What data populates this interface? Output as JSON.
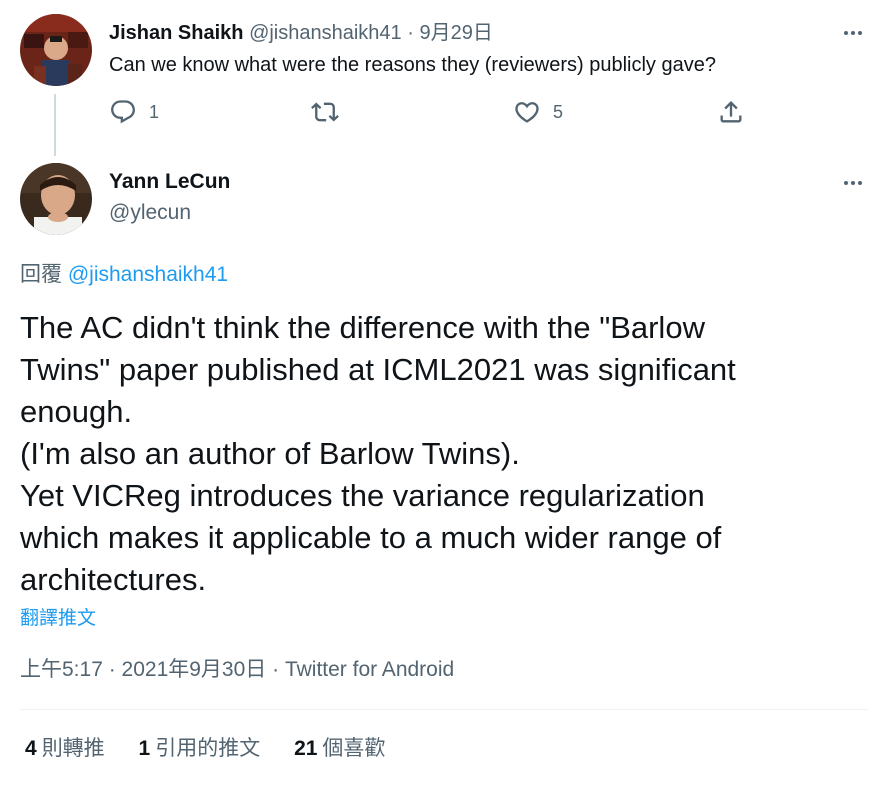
{
  "reply": {
    "name": "Jishan Shaikh",
    "handle": "@jishanshaikh41",
    "separator": "·",
    "date": "9月29日",
    "text": "Can we know what were the reasons they (reviewers) publicly gave?",
    "reply_count": "1",
    "like_count": "5"
  },
  "main": {
    "name": "Yann LeCun",
    "handle": "@ylecun",
    "replying_prefix": "回覆 ",
    "replying_mention": "@jishanshaikh41",
    "text_lines": [
      "The AC didn't think the difference with the \"Barlow",
      "Twins\" paper published at ICML2021 was significant",
      "enough.",
      "(I'm also an author of Barlow Twins).",
      "Yet VICReg introduces the variance regularization",
      "which makes it applicable to a much wider range of",
      "architectures."
    ],
    "translate_label": "翻譯推文",
    "time": "上午5:17 · 2021年9月30日 · ",
    "source": "Twitter for Android"
  },
  "stats": [
    {
      "num": "4",
      "label": "則轉推"
    },
    {
      "num": "1",
      "label": "引用的推文"
    },
    {
      "num": "21",
      "label": "個喜歡"
    }
  ],
  "colors": {
    "text": "#0f1419",
    "secondary": "#536471",
    "accent": "#1d9bf0",
    "divider": "#eff3f4",
    "thread_line": "#cfd9de"
  },
  "icons": [
    "reply-icon",
    "retweet-icon",
    "like-icon",
    "share-icon",
    "more-icon"
  ]
}
